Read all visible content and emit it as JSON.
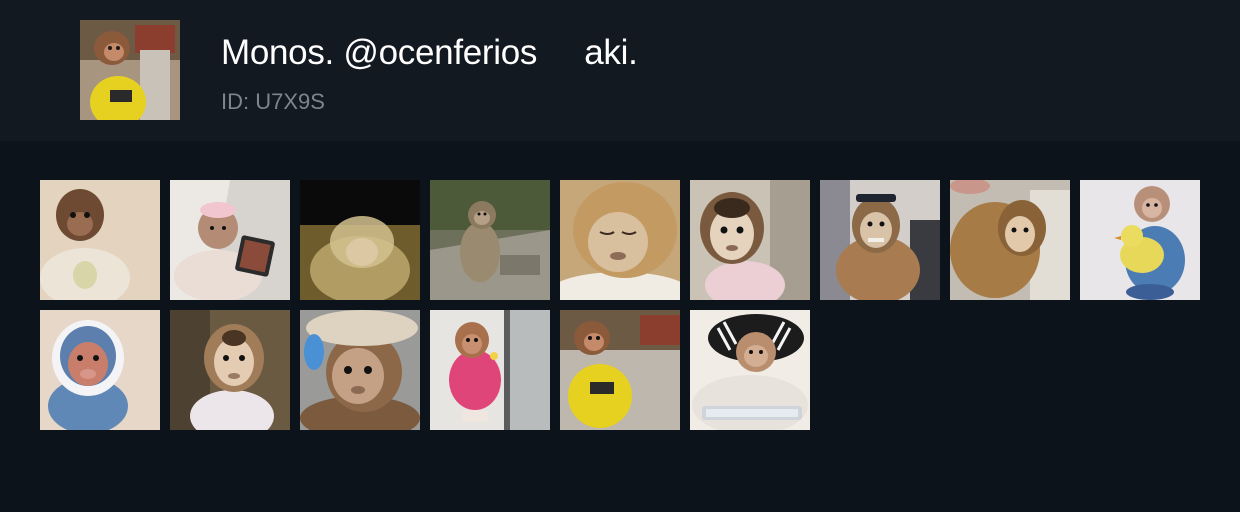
{
  "pack": {
    "title": "Monos. @ocenferios     aki.",
    "id_label": "ID: U7X9S"
  },
  "colors": {
    "background": "#0d131a",
    "header_background": "#121920",
    "title": "#ffffff",
    "subtitle": "#7d858d"
  },
  "stickers": [
    {
      "subject": "monkey-in-cream-hoodie"
    },
    {
      "subject": "monkey-in-pink-hat-with-phone"
    },
    {
      "subject": "blurry-monkey-hands-on-head"
    },
    {
      "subject": "monkey-sitting-on-stone-steps"
    },
    {
      "subject": "sleepy-capuchin-on-pillow"
    },
    {
      "subject": "capuchin-in-pink-shirt"
    },
    {
      "subject": "capuchin-with-sunglasses-on-head"
    },
    {
      "subject": "capuchin-lying-on-sofa"
    },
    {
      "subject": "monkey-holding-yellow-duckling"
    },
    {
      "subject": "monkey-in-blue-bonnet"
    },
    {
      "subject": "capuchin-in-floral-shirt"
    },
    {
      "subject": "capuchin-in-cap"
    },
    {
      "subject": "monkey-in-pink-outfit-by-window"
    },
    {
      "subject": "monkey-in-yellow-tshirt"
    },
    {
      "subject": "monkey-in-striped-jacket-with-tablet"
    }
  ]
}
